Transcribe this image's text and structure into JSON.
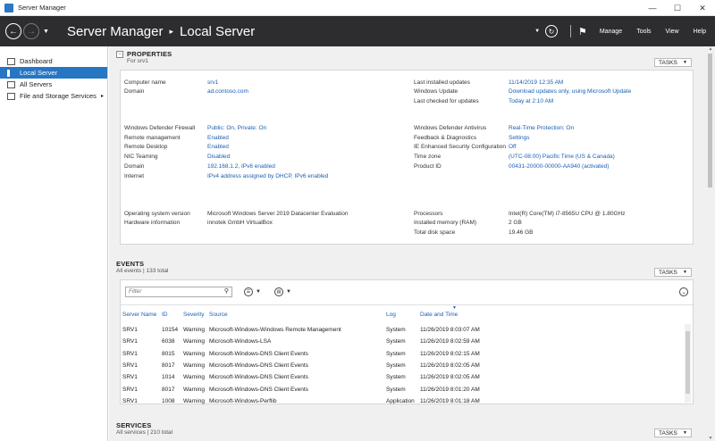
{
  "window": {
    "title": "Server Manager"
  },
  "header": {
    "app": "Server Manager",
    "page": "Local Server",
    "menus": [
      "Manage",
      "Tools",
      "View",
      "Help"
    ]
  },
  "sidebar": {
    "items": [
      {
        "label": "Dashboard"
      },
      {
        "label": "Local Server"
      },
      {
        "label": "All Servers"
      },
      {
        "label": "File and Storage Services"
      }
    ]
  },
  "properties": {
    "title": "PROPERTIES",
    "subtitle": "For srv1",
    "tasks_label": "TASKS",
    "left": [
      {
        "label": "Computer name",
        "value": "srv1",
        "link": true
      },
      {
        "label": "Domain",
        "value": "ad.contoso.com",
        "link": true
      },
      {
        "label": "Windows Defender Firewall",
        "value": "Public: On, Private: On",
        "link": true
      },
      {
        "label": "Remote management",
        "value": "Enabled",
        "link": true
      },
      {
        "label": "Remote Desktop",
        "value": "Enabled",
        "link": true
      },
      {
        "label": "NIC Teaming",
        "value": "Disabled",
        "link": true
      },
      {
        "label": "Domain",
        "value": "192.168.1.2, IPv6 enabled",
        "link": true
      },
      {
        "label": "Internet",
        "value": "IPv4 address assigned by DHCP, IPv6 enabled",
        "link": true
      },
      {
        "label": "Operating system version",
        "value": "Microsoft Windows Server 2019 Datacenter Evaluation",
        "link": false
      },
      {
        "label": "Hardware information",
        "value": "innotek GmbH VirtualBox",
        "link": false
      }
    ],
    "right": [
      {
        "label": "Last installed updates",
        "value": "11/14/2019 12:35 AM",
        "link": true
      },
      {
        "label": "Windows Update",
        "value": "Download updates only, using Microsoft Update",
        "link": true
      },
      {
        "label": "Last checked for updates",
        "value": "Today at 2:10 AM",
        "link": true
      },
      {
        "label": "Windows Defender Antivirus",
        "value": "Real-Time Protection: On",
        "link": true
      },
      {
        "label": "Feedback & Diagnostics",
        "value": "Settings",
        "link": true
      },
      {
        "label": "IE Enhanced Security Configuration",
        "value": "Off",
        "link": true
      },
      {
        "label": "Time zone",
        "value": "(UTC-08:00) Pacific Time (US & Canada)",
        "link": true
      },
      {
        "label": "Product ID",
        "value": "00431-20000-00000-AA940 (activated)",
        "link": true
      },
      {
        "label": "Processors",
        "value": "Intel(R) Core(TM) i7-8565U CPU @ 1.80GHz",
        "link": false
      },
      {
        "label": "Installed memory (RAM)",
        "value": "2 GB",
        "link": false
      },
      {
        "label": "Total disk space",
        "value": "19.46 GB",
        "link": false
      }
    ]
  },
  "events": {
    "title": "EVENTS",
    "subtitle": "All events | 133 total",
    "tasks_label": "TASKS",
    "filter_placeholder": "Filter",
    "columns": [
      "Server Name",
      "ID",
      "Severity",
      "Source",
      "Log",
      "Date and Time"
    ],
    "rows": [
      [
        "SRV1",
        "10154",
        "Warning",
        "Microsoft-Windows-Windows Remote Management",
        "System",
        "11/26/2019 8:03:07 AM"
      ],
      [
        "SRV1",
        "6038",
        "Warning",
        "Microsoft-Windows-LSA",
        "System",
        "11/26/2019 8:02:59 AM"
      ],
      [
        "SRV1",
        "8015",
        "Warning",
        "Microsoft-Windows-DNS Client Events",
        "System",
        "11/26/2019 8:02:15 AM"
      ],
      [
        "SRV1",
        "8017",
        "Warning",
        "Microsoft-Windows-DNS Client Events",
        "System",
        "11/26/2019 8:02:05 AM"
      ],
      [
        "SRV1",
        "1014",
        "Warning",
        "Microsoft-Windows-DNS Client Events",
        "System",
        "11/26/2019 8:02:05 AM"
      ],
      [
        "SRV1",
        "8017",
        "Warning",
        "Microsoft-Windows-DNS Client Events",
        "System",
        "11/26/2019 8:01:20 AM"
      ],
      [
        "SRV1",
        "1008",
        "Warning",
        "Microsoft-Windows-Perflib",
        "Application",
        "11/26/2019 8:01:18 AM"
      ]
    ]
  },
  "services": {
    "title": "SERVICES",
    "subtitle": "All services | 210 total",
    "tasks_label": "TASKS"
  }
}
